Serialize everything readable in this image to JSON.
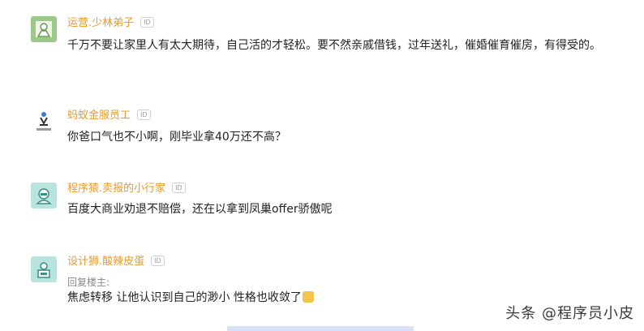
{
  "comments": [
    {
      "author": "运营.少林弟子",
      "id_badge": "ID",
      "text": "千万不要让家里人有太大期待，自己活的才轻松。要不然亲戚借钱，过年送礼，催婚催育催房，有得受的。"
    },
    {
      "author": "蚂蚁金服员工",
      "id_badge": "ID",
      "avatar_caption": "",
      "text": "你爸口气也不小啊，刚毕业拿40万还不高？"
    },
    {
      "author": "程序猿.卖报的小行家",
      "id_badge": "ID",
      "text": "百度大商业劝退不赔偿，还在以拿到凤巢offer骄傲呢"
    },
    {
      "author": "设计狮.酸辣皮蛋",
      "id_badge": "ID",
      "reply_label": "回复楼主:",
      "text": "焦虑转移 让他认识到自己的渺小 性格也收敛了",
      "emoji": "face-emoji"
    }
  ],
  "watermark": "头条 @程序员小皮",
  "colors": {
    "author": "#e79b2b",
    "text": "#222222",
    "avatar_green": "#9bc98a",
    "avatar_teal": "#b9e4de"
  }
}
